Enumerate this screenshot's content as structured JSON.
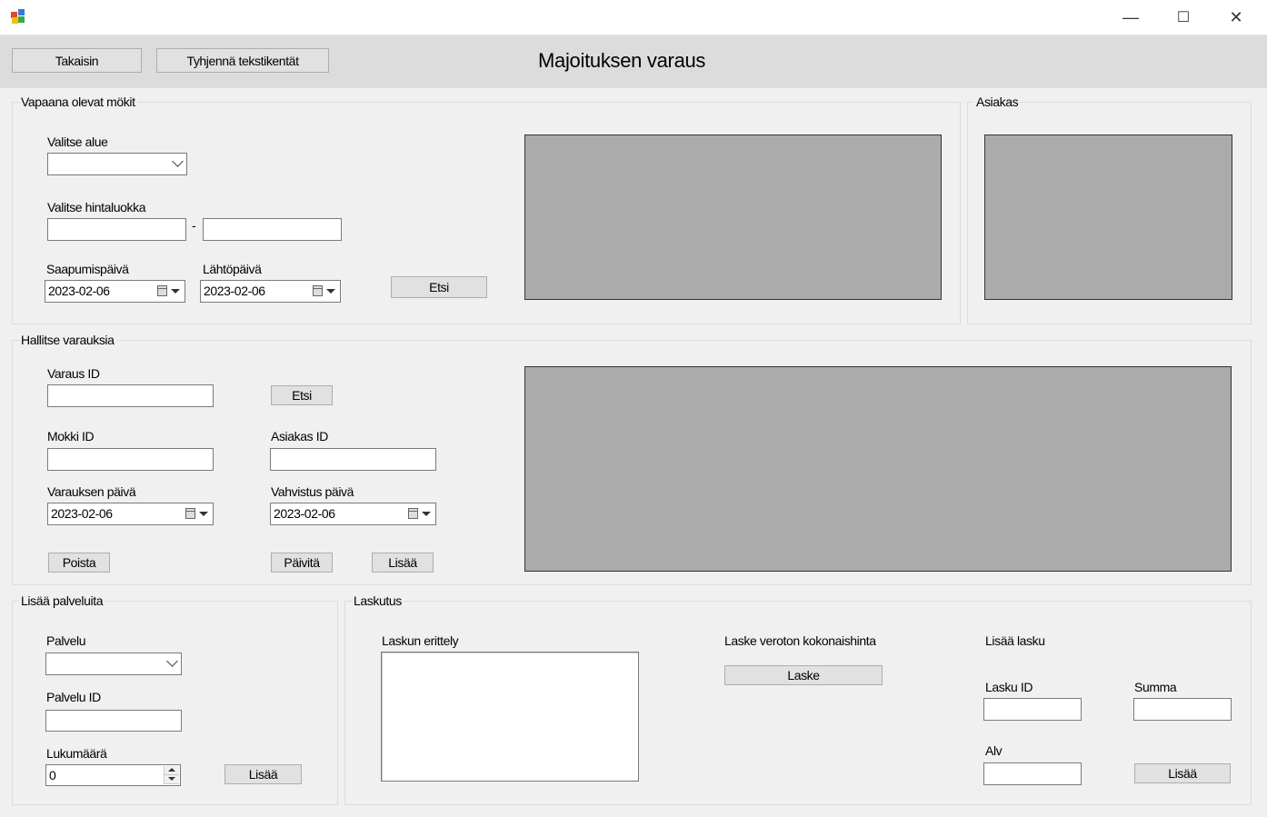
{
  "window": {
    "minimize": "—",
    "maximize": "☐",
    "close": "✕"
  },
  "toolbar": {
    "back": "Takaisin",
    "clear": "Tyhjennä tekstikentät",
    "title": "Majoituksen varaus"
  },
  "free_cabins": {
    "group_title": "Vapaana olevat mökit",
    "area_label": "Valitse alue",
    "price_label": "Valitse hintaluokka",
    "price_sep": "-",
    "arrival_label": "Saapumispäivä",
    "arrival_value": "2023-02-06",
    "departure_label": "Lähtöpäivä",
    "departure_value": "2023-02-06",
    "search_button": "Etsi"
  },
  "customer": {
    "group_title": "Asiakas"
  },
  "manage": {
    "group_title": "Hallitse varauksia",
    "booking_id_label": "Varaus ID",
    "search_button": "Etsi",
    "cabin_id_label": "Mokki ID",
    "customer_id_label": "Asiakas ID",
    "booking_date_label": "Varauksen päivä",
    "booking_date_value": "2023-02-06",
    "confirm_date_label": "Vahvistus päivä",
    "confirm_date_value": "2023-02-06",
    "delete_button": "Poista",
    "update_button": "Päivitä",
    "add_button": "Lisää"
  },
  "services": {
    "group_title": "Lisää palveluita",
    "service_label": "Palvelu",
    "service_id_label": "Palvelu ID",
    "quantity_label": "Lukumäärä",
    "quantity_value": "0",
    "add_button": "Lisää"
  },
  "billing": {
    "group_title": "Laskutus",
    "breakdown_label": "Laskun erittely",
    "calc_label": "Laske veroton kokonaishinta",
    "calc_button": "Laske",
    "add_invoice_label": "Lisää lasku",
    "invoice_id_label": "Lasku ID",
    "sum_label": "Summa",
    "vat_label": "Alv",
    "add_button": "Lisää"
  }
}
